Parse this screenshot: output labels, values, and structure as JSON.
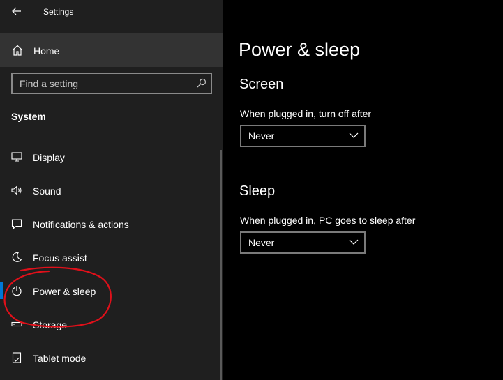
{
  "window": {
    "title": "Settings"
  },
  "sidebar": {
    "home_label": "Home",
    "search": {
      "placeholder": "Find a setting"
    },
    "section": "System",
    "items": [
      {
        "label": "Display",
        "icon": "monitor-icon"
      },
      {
        "label": "Sound",
        "icon": "speaker-icon"
      },
      {
        "label": "Notifications & actions",
        "icon": "message-icon"
      },
      {
        "label": "Focus assist",
        "icon": "moon-icon"
      },
      {
        "label": "Power & sleep",
        "icon": "power-icon",
        "selected": true
      },
      {
        "label": "Storage",
        "icon": "storage-icon"
      },
      {
        "label": "Tablet mode",
        "icon": "tablet-icon"
      }
    ]
  },
  "main": {
    "title": "Power & sleep",
    "screen": {
      "heading": "Screen",
      "label": "When plugged in, turn off after",
      "value": "Never"
    },
    "sleep": {
      "heading": "Sleep",
      "label": "When plugged in, PC goes to sleep after",
      "value": "Never"
    }
  },
  "colors": {
    "accent": "#0078d7",
    "annotation": "#e0101a",
    "sidebar_bg": "#1f1f1f",
    "content_bg": "#000000"
  }
}
